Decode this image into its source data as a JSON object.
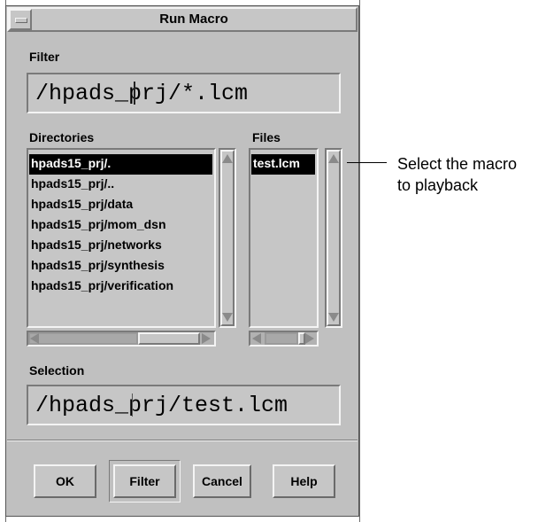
{
  "window": {
    "title": "Run Macro"
  },
  "filter": {
    "label": "Filter",
    "value": "/hpads_prj/*.lcm"
  },
  "directories": {
    "label": "Directories",
    "items": [
      "hpads15_prj/.",
      "hpads15_prj/..",
      "hpads15_prj/data",
      "hpads15_prj/mom_dsn",
      "hpads15_prj/networks",
      "hpads15_prj/synthesis",
      "hpads15_prj/verification"
    ],
    "selected": "hpads15_prj/."
  },
  "files": {
    "label": "Files",
    "items": [
      "test.lcm"
    ],
    "selected": "test.lcm"
  },
  "selection": {
    "label": "Selection",
    "value": "/hpads_prj/test.lcm"
  },
  "buttons": {
    "ok": "OK",
    "filter": "Filter",
    "cancel": "Cancel",
    "help": "Help"
  },
  "annotation": {
    "line1": "Select the macro",
    "line2": "to playback"
  }
}
